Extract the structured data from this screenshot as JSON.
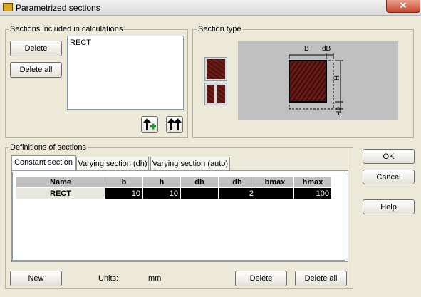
{
  "window": {
    "title": "Parametrized sections",
    "close": "✕"
  },
  "sections_group": {
    "legend": "Sections included in calculations",
    "delete_label": "Delete",
    "delete_all_label": "Delete all",
    "items": [
      "RECT"
    ]
  },
  "section_type": {
    "legend": "Section type",
    "dim_B": "B",
    "dim_dB": "dB",
    "dim_H": "H",
    "dim_dH": "dH"
  },
  "definitions": {
    "legend": "Definitions of sections",
    "tabs": [
      "Constant section",
      "Varying section (dh)",
      "Varying section (auto)"
    ],
    "columns": [
      "Name",
      "b",
      "h",
      "db",
      "dh",
      "bmax",
      "hmax"
    ],
    "rows": [
      [
        "RECT",
        "10",
        "10",
        "",
        "2",
        "",
        "100"
      ]
    ],
    "new_label": "New",
    "units_label": "Units:",
    "units_value": "mm",
    "delete_label": "Delete",
    "delete_all_label": "Delete all"
  },
  "right_buttons": {
    "ok": "OK",
    "cancel": "Cancel",
    "help": "Help"
  }
}
